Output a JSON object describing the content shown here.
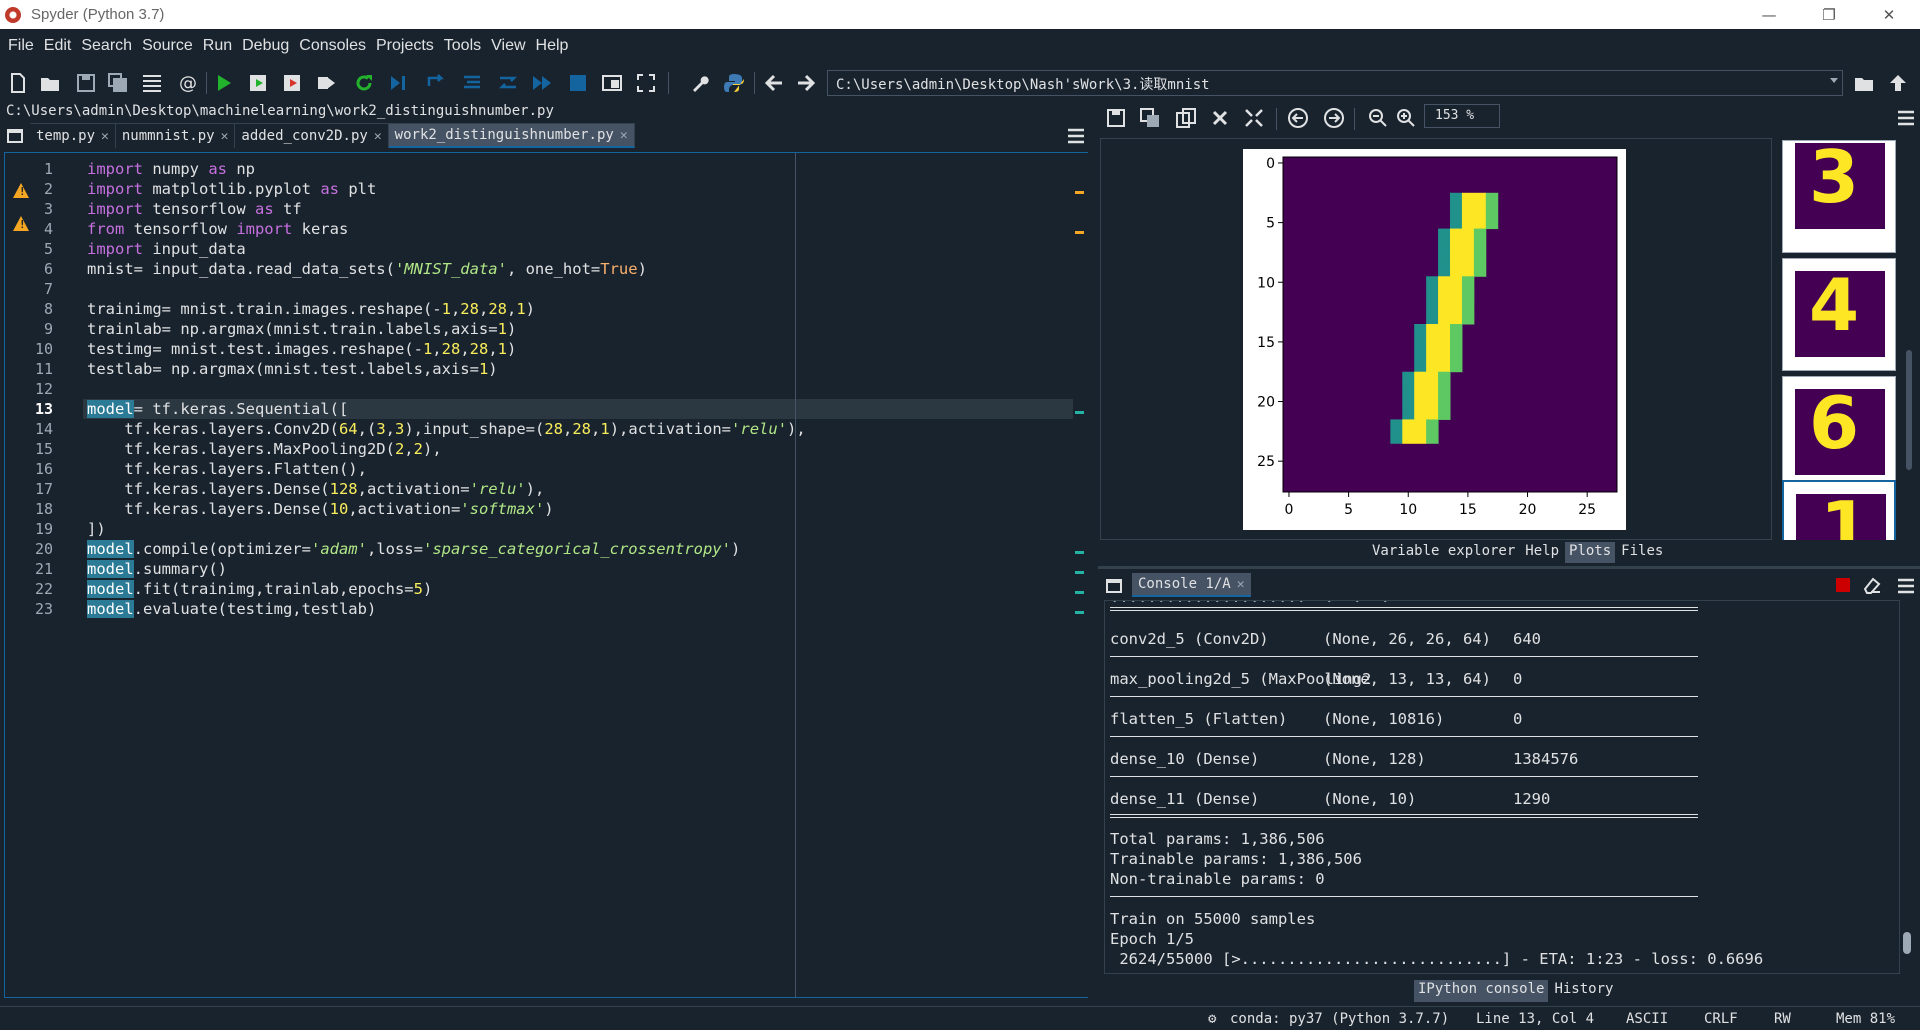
{
  "window": {
    "title": "Spyder (Python 3.7)"
  },
  "menu": [
    "File",
    "Edit",
    "Search",
    "Source",
    "Run",
    "Debug",
    "Consoles",
    "Projects",
    "Tools",
    "View",
    "Help"
  ],
  "toolbar": {
    "working_dir": "C:\\Users\\admin\\Desktop\\Nash'sWork\\3.读取mnist"
  },
  "editor": {
    "file_path": "C:\\Users\\admin\\Desktop\\machinelearning\\work2_distinguishnumber.py",
    "tabs": [
      "temp.py",
      "nummnist.py",
      "added_conv2D.py",
      "work2_distinguishnumber.py"
    ],
    "active_tab": 3,
    "current_line": 13,
    "line_numbers": [
      "1",
      "2",
      "3",
      "4",
      "5",
      "6",
      "7",
      "8",
      "9",
      "10",
      "11",
      "12",
      "13",
      "14",
      "15",
      "16",
      "17",
      "18",
      "19",
      "20",
      "21",
      "22",
      "23"
    ],
    "code": {
      "l1": [
        "import",
        " numpy ",
        "as",
        " np"
      ],
      "l2": [
        "import",
        " matplotlib.pyplot ",
        "as",
        " plt"
      ],
      "l3": [
        "import",
        " tensorflow ",
        "as",
        " tf"
      ],
      "l4": [
        "from",
        " tensorflow ",
        "import",
        " keras"
      ],
      "l5": [
        "import",
        " input_data"
      ],
      "l6": [
        "mnist= input_data.read_data_sets(",
        "'MNIST_data'",
        ", one_hot=",
        "True",
        ")"
      ],
      "l8": [
        "trainimg= mnist.train.images.reshape(-",
        "1",
        ",",
        "28",
        ",",
        "28",
        ",",
        "1",
        ")"
      ],
      "l9": [
        "trainlab= np.argmax(mnist.train.labels,axis=",
        "1",
        ")"
      ],
      "l10": [
        "testimg= mnist.test.images.reshape(-",
        "1",
        ",",
        "28",
        ",",
        "28",
        ",",
        "1",
        ")"
      ],
      "l11": [
        "testlab= np.argmax(mnist.test.labels,axis=",
        "1",
        ")"
      ],
      "l13": [
        "model",
        "= tf.keras.Sequential(["
      ],
      "l14": [
        "    tf.keras.layers.Conv2D(",
        "64",
        ",(",
        "3",
        ",",
        "3",
        "),input_shape=(",
        "28",
        ",",
        "28",
        ",",
        "1",
        "),activation=",
        "'relu'",
        "),"
      ],
      "l15": [
        "    tf.keras.layers.MaxPooling2D(",
        "2",
        ",",
        "2",
        "),"
      ],
      "l16": [
        "    tf.keras.layers.Flatten(),"
      ],
      "l17": [
        "    tf.keras.layers.Dense(",
        "128",
        ",activation=",
        "'relu'",
        "),"
      ],
      "l18": [
        "    tf.keras.layers.Dense(",
        "10",
        ",activation=",
        "'softmax'",
        ")"
      ],
      "l19": [
        "])"
      ],
      "l20": [
        "model",
        ".compile(optimizer=",
        "'adam'",
        ",loss=",
        "'sparse_categorical_crossentropy'",
        ")"
      ],
      "l21": [
        "model",
        ".summary()"
      ],
      "l22": [
        "model",
        ".fit(trainimg,trainlab,epochs=",
        "5",
        ")"
      ],
      "l23": [
        "model",
        ".evaluate(testimg,testlab)"
      ]
    }
  },
  "plots": {
    "zoom": "153 %",
    "y_ticks": [
      "0",
      "5",
      "10",
      "15",
      "20",
      "25"
    ],
    "x_ticks": [
      "0",
      "5",
      "10",
      "15",
      "20",
      "25"
    ],
    "thumbnails": [
      "3",
      "4",
      "6",
      "1"
    ]
  },
  "right_tabs_top": [
    "Variable explorer",
    "Help",
    "Plots",
    "Files"
  ],
  "right_tabs_top_active": "Plots",
  "console": {
    "tab": "Console 1/A",
    "rows": [
      {
        "layer": "conv2d_5 (Conv2D)",
        "shape": "(None, 26, 26, 64)",
        "params": "640"
      },
      {
        "layer": "max_pooling2d_5 (MaxPooling2",
        "shape": "(None, 13, 13, 64)",
        "params": "0"
      },
      {
        "layer": "flatten_5 (Flatten)",
        "shape": "(None, 10816)",
        "params": "0"
      },
      {
        "layer": "dense_10 (Dense)",
        "shape": "(None, 128)",
        "params": "1384576"
      },
      {
        "layer": "dense_11 (Dense)",
        "shape": "(None, 10)",
        "params": "1290"
      }
    ],
    "total": "Total params: 1,386,506",
    "trainable": "Trainable params: 1,386,506",
    "non_trainable": "Non-trainable params: 0",
    "train_on": "Train on 55000 samples",
    "epoch": "Epoch 1/5",
    "progress": " 2624/55000 [>............................] - ETA: 1:23 - loss: 0.6696"
  },
  "right_tabs_bottom": [
    "IPython console",
    "History"
  ],
  "right_tabs_bottom_active": "IPython console",
  "status": {
    "env": "conda: py37 (Python 3.7.7)",
    "position": "Line 13, Col 4",
    "encoding": "ASCII",
    "eol": "CRLF",
    "perm": "RW",
    "mem": "Mem 81%"
  },
  "mnist_digit": [
    [
      15,
      3
    ],
    [
      15,
      4
    ],
    [
      15,
      5
    ],
    [
      14,
      6
    ],
    [
      14,
      7
    ],
    [
      14,
      8
    ],
    [
      14,
      9
    ],
    [
      13,
      10
    ],
    [
      13,
      11
    ],
    [
      13,
      12
    ],
    [
      13,
      13
    ],
    [
      12,
      14
    ],
    [
      12,
      15
    ],
    [
      12,
      16
    ],
    [
      12,
      17
    ],
    [
      11,
      18
    ],
    [
      11,
      19
    ],
    [
      11,
      20
    ],
    [
      11,
      21
    ],
    [
      10,
      22
    ],
    [
      10,
      23
    ]
  ],
  "colors": {
    "accent": "#1464a0",
    "bg": "#19232d",
    "viridis_low": "#440154",
    "viridis_high": "#fde725"
  }
}
